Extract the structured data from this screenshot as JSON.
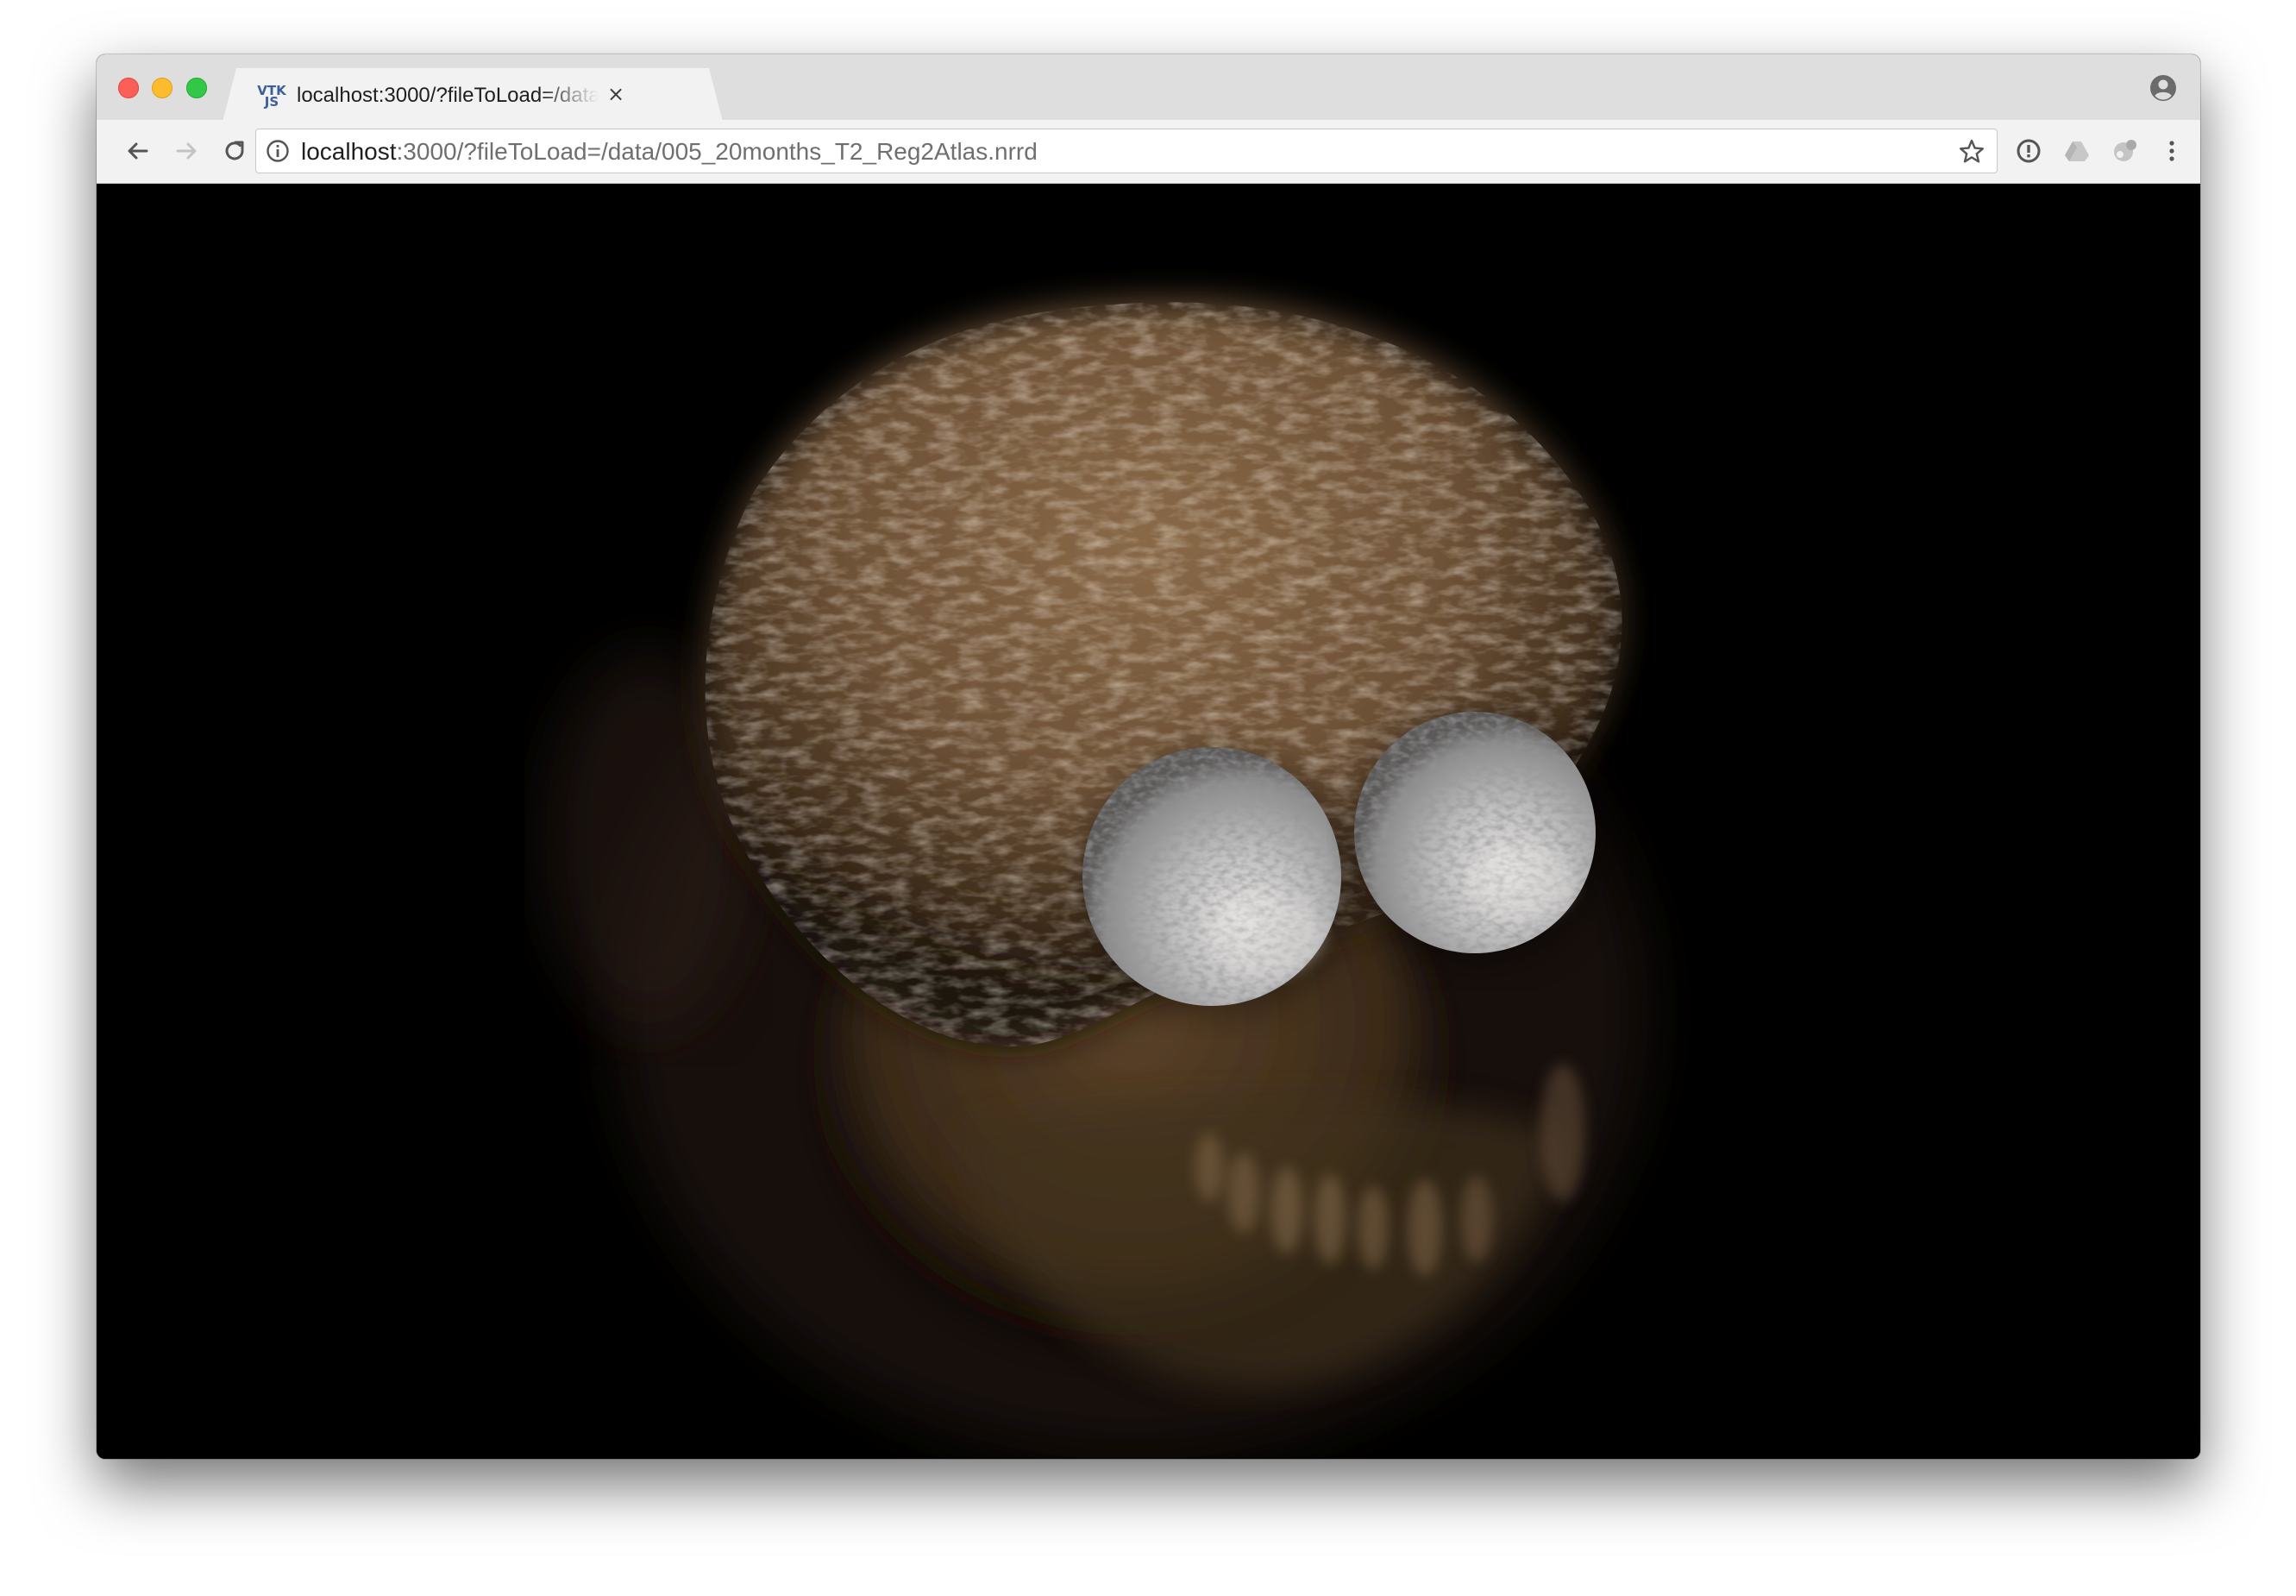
{
  "browser": {
    "tab": {
      "title": "localhost:3000/?fileToLoad=/data/005_20months_T2_Reg2Atlas.nrrd",
      "favicon_text": "VTK JS",
      "close_glyph": "×"
    },
    "address_bar": {
      "host": "localhost",
      "rest": ":3000/?fileToLoad=/data/005_20months_T2_Reg2Atlas.nrrd"
    },
    "icons": {
      "back": "arrow-left-icon",
      "forward": "arrow-right-icon",
      "reload": "reload-icon",
      "info": "info-icon",
      "bookmark": "star-icon",
      "extension_1": "alert-circle-icon",
      "extension_2": "drive-icon",
      "extension_3": "puzzle-icon",
      "menu": "kebab-menu-icon",
      "profile": "profile-icon"
    }
  },
  "viewport": {
    "content": "vtk.js volume rendering",
    "background": "#000000",
    "accent_colors": {
      "skull": "#8a6a48",
      "eyes": "#cfcfd0"
    }
  },
  "colors": {
    "tabstrip": "#dedede",
    "toolbar": "#f2f2f2",
    "close": "#fc5f57",
    "minimize": "#fdbc2e",
    "maximize": "#33c748"
  }
}
